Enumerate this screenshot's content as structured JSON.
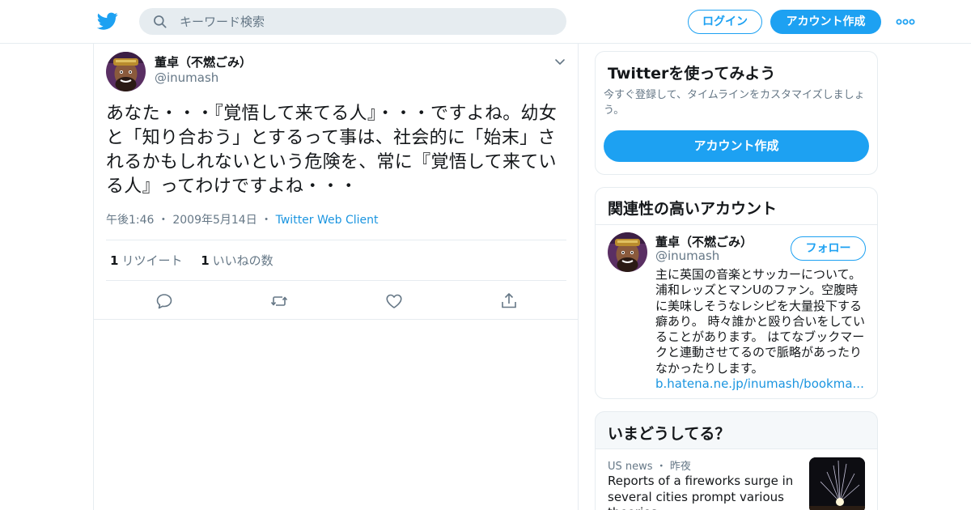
{
  "header": {
    "logo_icon": "twitter-bird-icon",
    "search_placeholder": "キーワード検索",
    "login_label": "ログイン",
    "signup_label": "アカウント作成",
    "more_icon": "more-dots-icon",
    "accent_color": "#1da1f2"
  },
  "tweet": {
    "author_name": "董卓（不燃ごみ）",
    "author_handle": "@inumash",
    "text": "あなた・・・『覚悟して来てる人』・・・ですよね。幼女と「知り合おう」とするって事は、社会的に「始末」されるかもしれないという危険を、常に『覚悟して来ている人』ってわけですよね・・・",
    "time": "午後1:46",
    "date": "2009年5月14日",
    "separator": "・",
    "client": "Twitter Web Client",
    "retweet_count": "1",
    "retweet_label": "リツイート",
    "like_count": "1",
    "like_label": "いいねの数"
  },
  "signup_card": {
    "title": "Twitterを使ってみよう",
    "description": "今すぐ登録して、タイムラインをカスタマイズしましょう。",
    "button_label": "アカウント作成"
  },
  "related_card": {
    "title": "関連性の高いアカウント",
    "account": {
      "name": "董卓（不燃ごみ）",
      "handle": "@inumash",
      "follow_label": "フォロー",
      "bio": "主に英国の音楽とサッカーについて。浦和レッズとマンUのファン。空腹時に美味しそうなレシピを大量投下する癖あり。 時々誰かと殴り合いをしていることがあります。 はてなブックマークと連動させてるので脈略があったりなかったりします。",
      "link": "b.hatena.ne.jp/inumash/bookma..."
    }
  },
  "trends_card": {
    "title": "いまどうしてる？",
    "item": {
      "context_source": "US news",
      "separator": "・",
      "context_time": "昨夜",
      "headline": "Reports of a fireworks surge in several cities prompt various theories"
    }
  }
}
